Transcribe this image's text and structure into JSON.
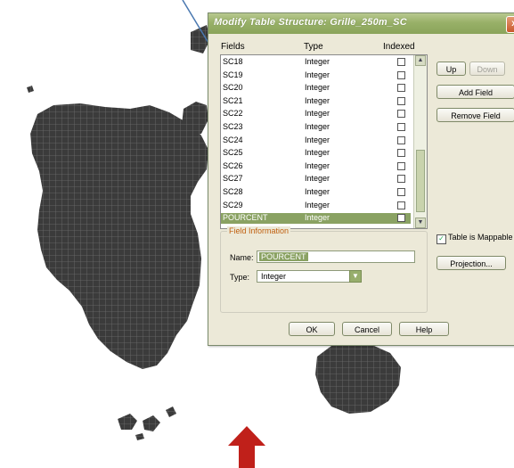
{
  "dialog": {
    "title": "Modify Table Structure: Grille_250m_SC",
    "close_glyph": "x",
    "headers": {
      "fields": "Fields",
      "type": "Type",
      "indexed": "Indexed"
    },
    "fields": [
      {
        "name": "SC18",
        "type": "Integer",
        "indexed": false
      },
      {
        "name": "SC19",
        "type": "Integer",
        "indexed": false
      },
      {
        "name": "SC20",
        "type": "Integer",
        "indexed": false
      },
      {
        "name": "SC21",
        "type": "Integer",
        "indexed": false
      },
      {
        "name": "SC22",
        "type": "Integer",
        "indexed": false
      },
      {
        "name": "SC23",
        "type": "Integer",
        "indexed": false
      },
      {
        "name": "SC24",
        "type": "Integer",
        "indexed": false
      },
      {
        "name": "SC25",
        "type": "Integer",
        "indexed": false
      },
      {
        "name": "SC26",
        "type": "Integer",
        "indexed": false
      },
      {
        "name": "SC27",
        "type": "Integer",
        "indexed": false
      },
      {
        "name": "SC28",
        "type": "Integer",
        "indexed": false
      },
      {
        "name": "SC29",
        "type": "Integer",
        "indexed": false
      },
      {
        "name": "POURCENT",
        "type": "Integer",
        "indexed": false,
        "selected": true
      }
    ],
    "scroll": {
      "up": "▲",
      "down": "▼"
    },
    "buttons": {
      "up": "Up",
      "down": "Down",
      "add_field": "Add Field",
      "remove_field": "Remove Field"
    },
    "field_info": {
      "legend": "Field Information",
      "name_label": "Name:",
      "name_value": "POURCENT",
      "type_label": "Type:",
      "type_value": "Integer",
      "dropdown_glyph": "▼"
    },
    "table_mappable": {
      "label": "Table is Mappable",
      "checked": true,
      "check_glyph": "✓"
    },
    "projection_button": "Projection...",
    "footer": {
      "ok": "OK",
      "cancel": "Cancel",
      "help": "Help"
    }
  },
  "colors": {
    "selection": "#8aa263",
    "titlebar": "#98b068",
    "map_fill": "#3a3a3a",
    "arrow_red": "#c0201a",
    "pointer_line": "#4a78b0"
  }
}
